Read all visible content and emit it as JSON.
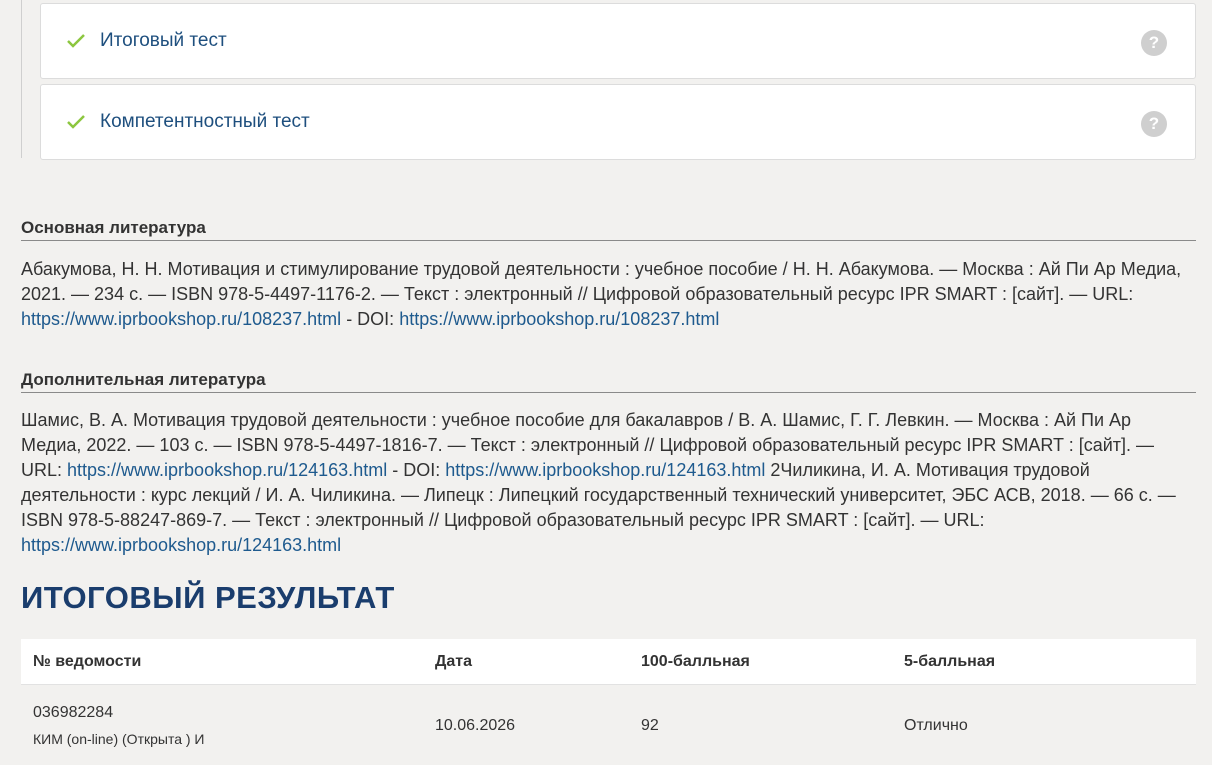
{
  "tests": [
    {
      "title": "Итоговый тест",
      "help": "?"
    },
    {
      "title": "Компетентностный тест",
      "help": "?"
    }
  ],
  "main_lit": {
    "heading": "Основная литература",
    "text": "Абакумова, Н. Н. Мотивация и стимулирование трудовой деятельности : учебное пособие / Н. Н. Абакумова. — Москва : Ай Пи Ар Медиа, 2021. — 234 с. — ISBN 978-5-4497-1176-2. — Текст : электронный // Цифровой образовательный ресурс IPR SMART : [сайт]. — URL: ",
    "url": "https://www.iprbookshop.ru/108237.html",
    "doi_label": " - DOI: ",
    "doi_url": "https://www.iprbookshop.ru/108237.html"
  },
  "extra_lit": {
    "heading": "Дополнительная литература",
    "text1": "Шамис, В. А. Мотивация трудовой деятельности : учебное пособие для бакалавров / В. А. Шамис, Г. Г. Левкин. — Москва : Ай Пи Ар Медиа, 2022. — 103 с. — ISBN 978-5-4497-1816-7. — Текст : электронный // Цифровой образовательный ресурс IPR SMART : [сайт]. — URL: ",
    "url1": "https://www.iprbookshop.ru/124163.html",
    "doi_label": " - DOI: ",
    "doi_url": "https://www.iprbookshop.ru/124163.html",
    "text2": " 2Чиликина, И. А. Мотивация трудовой деятельности : курс лекций / И. А. Чиликина. — Липецк : Липецкий государственный технический университет, ЭБС АСВ, 2018. — 66 с. — ISBN 978-5-88247-869-7. — Текст : электронный // Цифровой образовательный ресурс IPR SMART : [сайт]. — URL: ",
    "url2": "https://www.iprbookshop.ru/124163.html"
  },
  "result": {
    "title": "ИТОГОВЫЙ РЕЗУЛЬТАТ",
    "headers": [
      "№ ведомости",
      "Дата",
      "100-балльная",
      "5-балльная"
    ],
    "row": {
      "number": "036982284",
      "sub": "КИМ (on-line) (Открыта ) И",
      "date": "10.06.2026",
      "score100": "92",
      "score5": "Отлично"
    }
  },
  "colors": {
    "check": "#8cc63f",
    "link": "#1e5a8e",
    "title": "#1a3d6d"
  }
}
